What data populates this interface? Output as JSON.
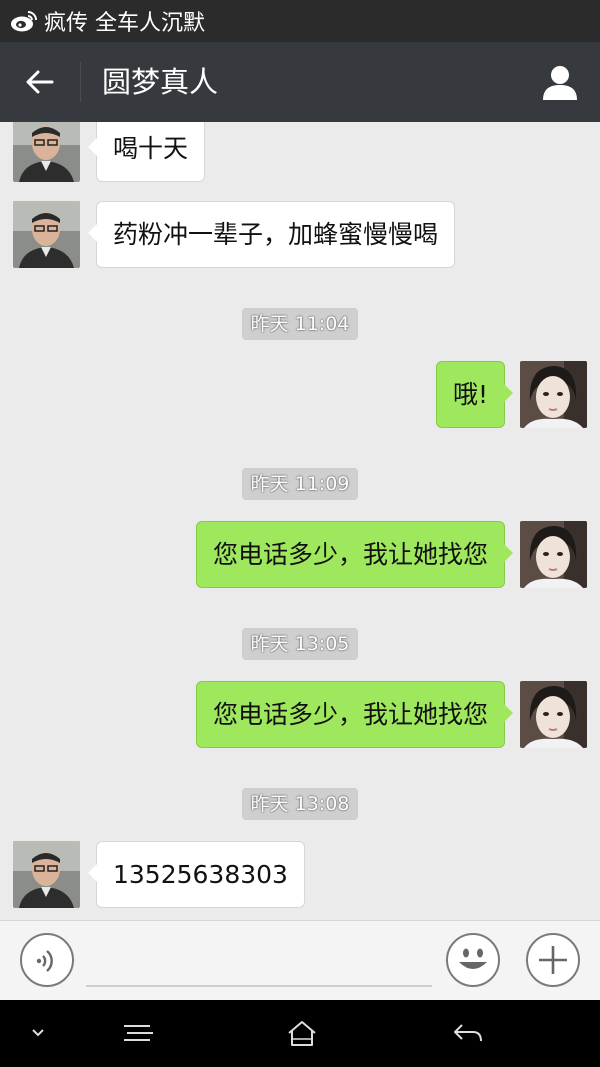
{
  "status_bar": {
    "app_icon": "weibo-icon",
    "text": "疯传 全车人沉默"
  },
  "header": {
    "back_icon": "back-arrow-icon",
    "title": "圆梦真人",
    "profile_icon": "person-icon"
  },
  "messages": [
    {
      "from": "other",
      "text": "喝十天"
    },
    {
      "from": "other",
      "text": "药粉冲一辈子，加蜂蜜慢慢喝"
    },
    {
      "type": "timestamp",
      "text": "昨天 11:04"
    },
    {
      "from": "me",
      "text": "哦!"
    },
    {
      "type": "timestamp",
      "text": "昨天 11:09"
    },
    {
      "from": "me",
      "text": "您电话多少，我让她找您"
    },
    {
      "type": "timestamp",
      "text": "昨天 13:05"
    },
    {
      "from": "me",
      "text": "您电话多少，我让她找您"
    },
    {
      "type": "timestamp",
      "text": "昨天 13:08"
    },
    {
      "from": "other",
      "text": "13525638303"
    }
  ],
  "input_bar": {
    "voice_icon": "voice-icon",
    "emoji_icon": "smiley-icon",
    "more_icon": "plus-icon",
    "text_value": ""
  },
  "nav_bar": {
    "icons": [
      "chevron-down-icon",
      "menu-icon",
      "home-icon",
      "back-icon"
    ]
  },
  "colors": {
    "title_bar": "#36393d",
    "status_bar": "#2b2b2b",
    "chat_bg": "#ebebeb",
    "outgoing_bubble": "#9fe85e",
    "incoming_bubble": "#ffffff"
  }
}
